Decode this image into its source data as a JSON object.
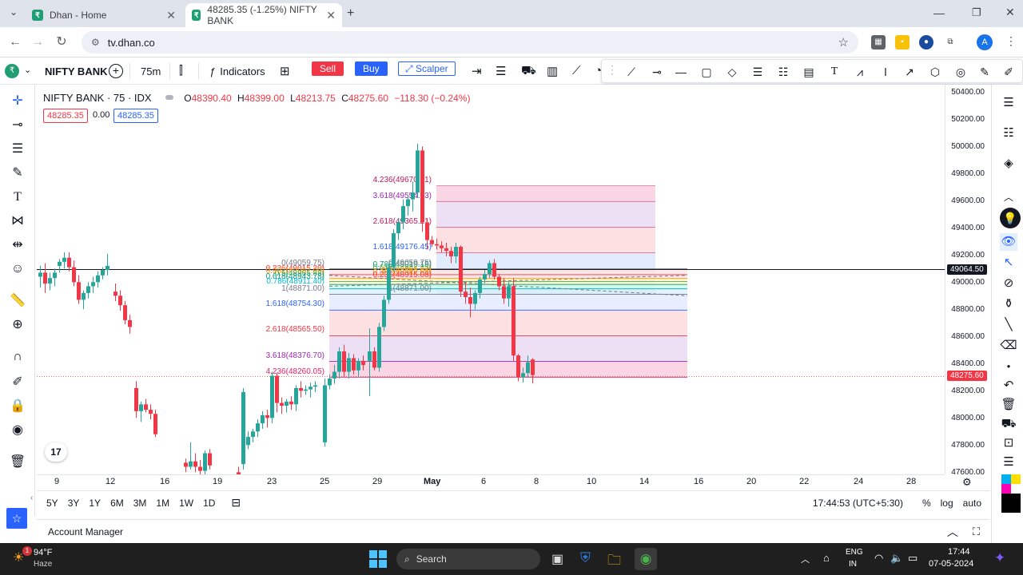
{
  "browser": {
    "tabs": [
      {
        "title": "Dhan - Home",
        "active": false
      },
      {
        "title": "48285.35 (-1.25%) NIFTY BANK",
        "active": true
      }
    ],
    "new_tab": "+",
    "url": "tv.dhan.co",
    "profile": "A"
  },
  "toolbar": {
    "symbol": "NIFTY BANK",
    "interval": "75m",
    "indicators_label": "Indicators",
    "sell_label": "Sell",
    "buy_label": "Buy",
    "scalper_label": "Scalper"
  },
  "legend": {
    "title": "NIFTY BANK · 75 · IDX",
    "open_label": "O",
    "open": "48390.40",
    "high_label": "H",
    "high": "48399.00",
    "low_label": "L",
    "low": "48213.75",
    "close_label": "C",
    "close": "48275.60",
    "change": "−118.30 (−0.24%)",
    "bid": "48285.35",
    "spread": "0.00",
    "ask": "48285.35"
  },
  "price_axis": {
    "ticks": [
      "50400.00",
      "50200.00",
      "50000.00",
      "49800.00",
      "49600.00",
      "49400.00",
      "49200.00",
      "49000.00",
      "48800.00",
      "48600.00",
      "48400.00",
      "48200.00",
      "48000.00",
      "47800.00",
      "47600.00"
    ],
    "crosshair_price": "49064.50",
    "last_price": "48275.60"
  },
  "time_axis": {
    "ticks": [
      "9",
      "12",
      "16",
      "19",
      "23",
      "25",
      "29",
      "May",
      "6",
      "8",
      "10",
      "14",
      "16",
      "20",
      "22",
      "24",
      "28"
    ]
  },
  "fib_labels": {
    "upper": [
      "4.236(49670.71)",
      "3.618(49554.23)",
      "2.618(49365.21)",
      "1.618(49176.45)",
      "0.786(49019.15)",
      "0.618(48987.35)",
      "0.5(48965.04)",
      "0.382(48942.64)",
      "0.236(48915.08)",
      "1(48871.00)",
      "0(49059.75)"
    ],
    "lower": [
      "0(49059.75)",
      "0.236(49015.20)",
      "0.382(48987.99)",
      "0.5(48965.88)",
      "0.618(48943.78)",
      "0.786(48911.40)",
      "1(48871.00)",
      "1.618(48754.30)",
      "2.618(48565.50)",
      "3.618(48376.70)",
      "4.236(48260.05)"
    ]
  },
  "range_bar": {
    "ranges": [
      "5Y",
      "3Y",
      "1Y",
      "6M",
      "3M",
      "1M",
      "1W",
      "1D"
    ],
    "time": "17:44:53 (UTC+5:30)",
    "percent": "%",
    "log": "log",
    "auto": "auto"
  },
  "account_manager": "Account Manager",
  "taskbar": {
    "weather_temp": "94°F",
    "weather_desc": "Haze",
    "search_placeholder": "Search",
    "lang1": "ENG",
    "lang2": "IN",
    "clock_time": "17:44",
    "clock_date": "07-05-2024",
    "badge": "1"
  },
  "colors": {
    "up": "#26a69a",
    "down": "#f23645",
    "accent": "#2962ff"
  }
}
